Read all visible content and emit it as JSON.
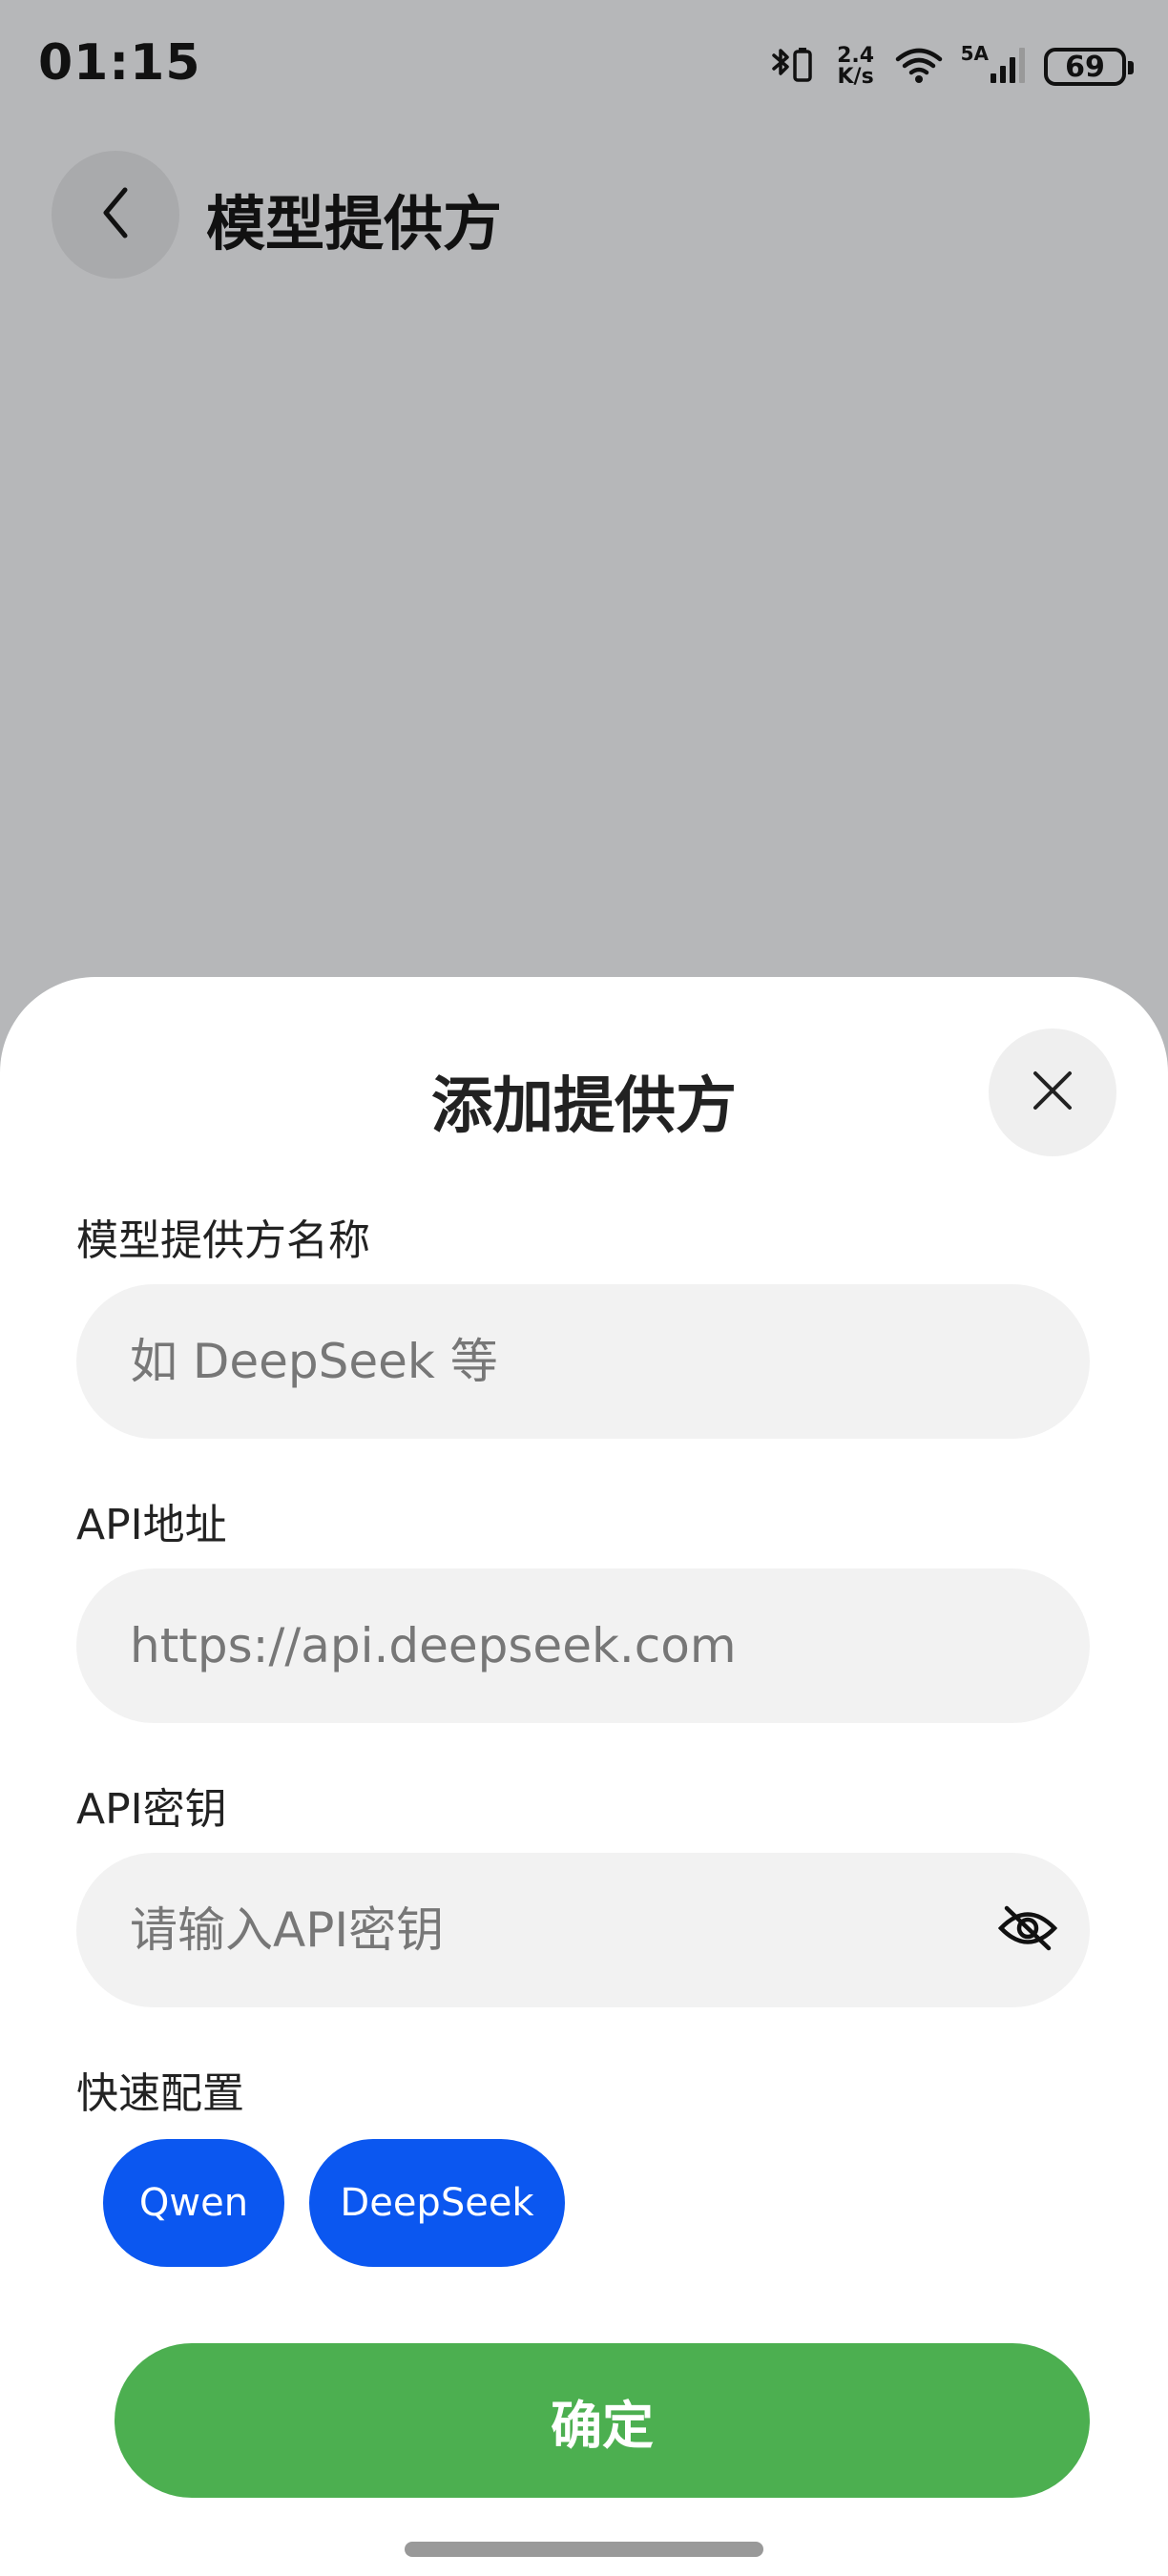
{
  "status_bar": {
    "time": "01:15",
    "net_speed_value": "2.4",
    "net_speed_unit": "K/s",
    "signal_label": "5A",
    "battery": "69",
    "icons": [
      "bluetooth-icon",
      "wifi-icon",
      "cellular-signal-icon",
      "battery-icon"
    ]
  },
  "header": {
    "title": "模型提供方",
    "back_icon": "chevron-left-icon"
  },
  "dialog": {
    "title": "添加提供方",
    "close_icon": "close-icon",
    "fields": [
      {
        "label": "模型提供方名称",
        "value": "",
        "placeholder": "如 DeepSeek 等"
      },
      {
        "label": "API地址",
        "value": "",
        "placeholder": "https://api.deepseek.com"
      },
      {
        "label": "API密钥",
        "value": "",
        "placeholder": "请输入API密钥",
        "toggle_icon": "eye-off-icon"
      }
    ],
    "quick_config": {
      "label": "快速配置",
      "options": [
        "Qwen",
        "DeepSeek"
      ]
    },
    "confirm_label": "确定"
  },
  "colors": {
    "overlay": "#b6b7b9",
    "chip": "#0b57f0",
    "confirm": "#4caf50"
  }
}
